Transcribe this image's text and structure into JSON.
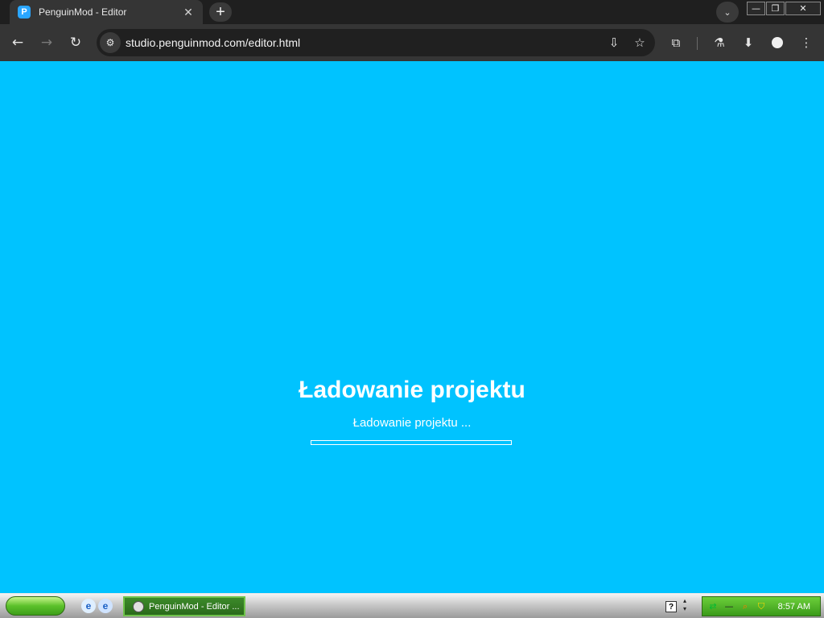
{
  "browser": {
    "tab": {
      "title": "PenguinMod - Editor",
      "favicon": "penguinmod-icon",
      "close_glyph": "✕"
    },
    "new_tab_glyph": "+",
    "tab_search_glyph": "⌄",
    "window_controls": {
      "minimize": "—",
      "restore": "❐",
      "close": "✕"
    },
    "toolbar": {
      "back_glyph": "←",
      "forward_glyph": "→",
      "reload_glyph": "↻",
      "url": "studio.penguinmod.com/editor.html",
      "site_info_glyph": "⚙",
      "install_glyph": "⇩",
      "bookmark_glyph": "☆",
      "extensions_glyph": "⧉",
      "labs_glyph": "⚗",
      "downloads_glyph": "⬇",
      "menu_glyph": "⋮"
    }
  },
  "page": {
    "background": "#00c3ff",
    "loading_title": "Ładowanie projektu",
    "loading_subtitle": "Ładowanie projektu ...",
    "progress": 0
  },
  "taskbar": {
    "start_button": "start-button",
    "quick_launch": [
      "ie-icon",
      "ie-alt-icon"
    ],
    "task_button": "PenguinMod - Editor ...",
    "help_glyph": "?",
    "tray_icons": [
      "network-icon",
      "volume-icon",
      "search-icon",
      "security-icon"
    ],
    "clock": "8:57 AM"
  }
}
